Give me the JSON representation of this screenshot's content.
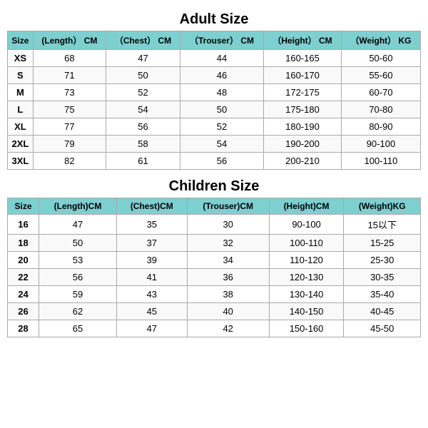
{
  "adult": {
    "title": "Adult Size",
    "headers": [
      "Size",
      "(Length） CM",
      "（Chest） CM",
      "（Trouser） CM",
      "（Height） CM",
      "（Weight） KG"
    ],
    "rows": [
      [
        "XS",
        "68",
        "47",
        "44",
        "160-165",
        "50-60"
      ],
      [
        "S",
        "71",
        "50",
        "46",
        "160-170",
        "55-60"
      ],
      [
        "M",
        "73",
        "52",
        "48",
        "172-175",
        "60-70"
      ],
      [
        "L",
        "75",
        "54",
        "50",
        "175-180",
        "70-80"
      ],
      [
        "XL",
        "77",
        "56",
        "52",
        "180-190",
        "80-90"
      ],
      [
        "2XL",
        "79",
        "58",
        "54",
        "190-200",
        "90-100"
      ],
      [
        "3XL",
        "82",
        "61",
        "56",
        "200-210",
        "100-110"
      ]
    ]
  },
  "children": {
    "title": "Children Size",
    "headers": [
      "Size",
      "(Length)CM",
      "(Chest)CM",
      "(Trouser)CM",
      "(Height)CM",
      "(Weight)KG"
    ],
    "rows": [
      [
        "16",
        "47",
        "35",
        "30",
        "90-100",
        "15以下"
      ],
      [
        "18",
        "50",
        "37",
        "32",
        "100-110",
        "15-25"
      ],
      [
        "20",
        "53",
        "39",
        "34",
        "110-120",
        "25-30"
      ],
      [
        "22",
        "56",
        "41",
        "36",
        "120-130",
        "30-35"
      ],
      [
        "24",
        "59",
        "43",
        "38",
        "130-140",
        "35-40"
      ],
      [
        "26",
        "62",
        "45",
        "40",
        "140-150",
        "40-45"
      ],
      [
        "28",
        "65",
        "47",
        "42",
        "150-160",
        "45-50"
      ]
    ]
  }
}
